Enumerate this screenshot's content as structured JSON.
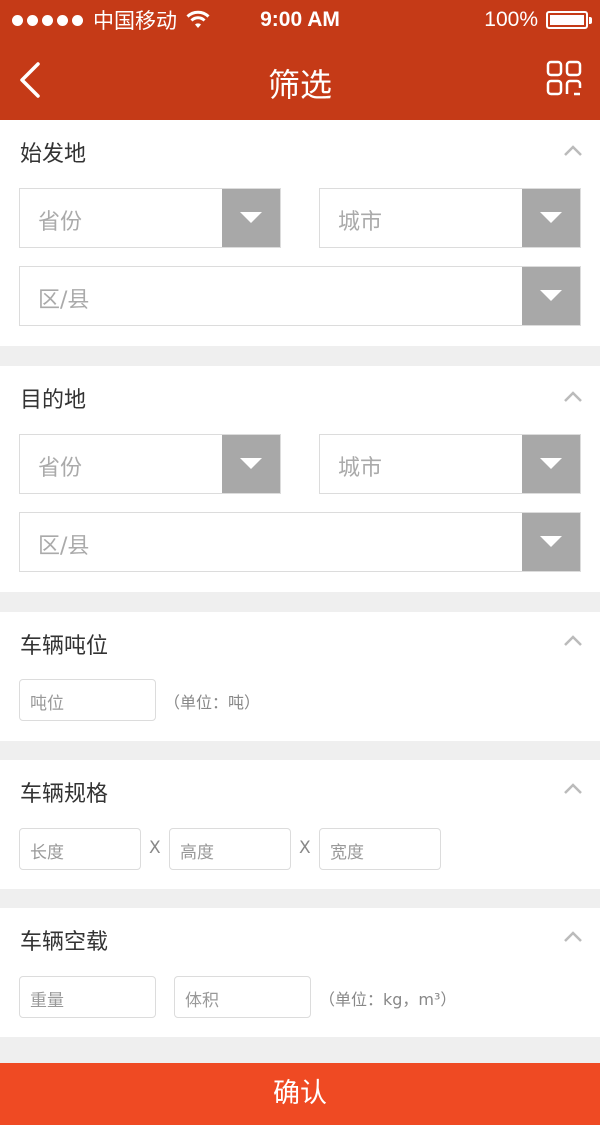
{
  "status": {
    "carrier": "中国移动",
    "time": "9:00 AM",
    "battery": "100%"
  },
  "nav": {
    "title": "筛选",
    "back_icon": "chevron-left-icon",
    "scan_icon": "grid-scan-icon"
  },
  "origin": {
    "title": "始发地",
    "province": "省份",
    "city": "城市",
    "district": "区/县"
  },
  "destination": {
    "title": "目的地",
    "province": "省份",
    "city": "城市",
    "district": "区/县"
  },
  "tonnage": {
    "title": "车辆吨位",
    "placeholder": "吨位",
    "unit": "（单位：吨）"
  },
  "spec": {
    "title": "车辆规格",
    "length": "长度",
    "height": "高度",
    "width": "宽度",
    "sep": "X"
  },
  "load": {
    "title": "车辆空载",
    "weight": "重量",
    "volume": "体积",
    "unit": "（单位：kg，m³）"
  },
  "confirm": "确认",
  "colors": {
    "header": "#c53a17",
    "confirm": "#ef4a23",
    "arrow_box": "#a8a8a8"
  }
}
